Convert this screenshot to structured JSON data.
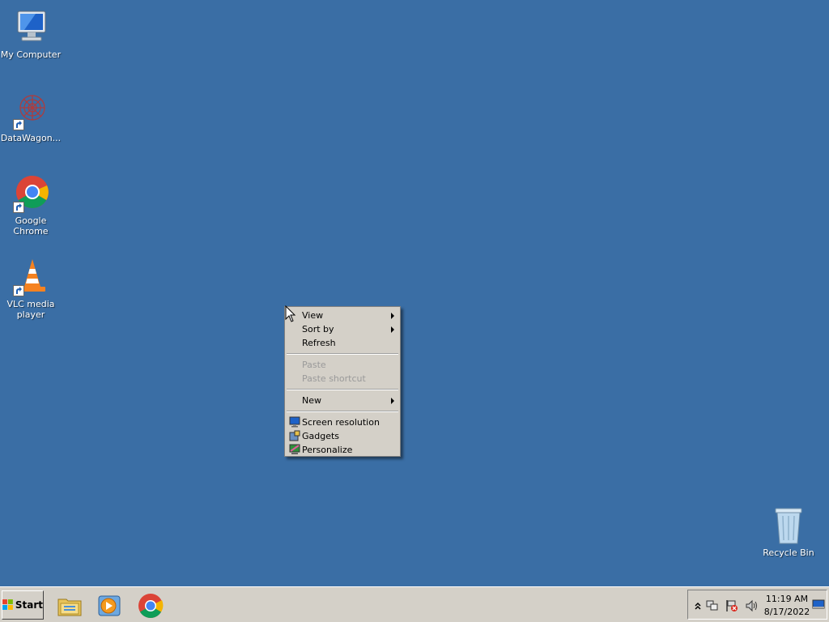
{
  "desktop": {
    "icons": [
      {
        "label": "My Computer",
        "icon": "computer-icon"
      },
      {
        "label": "DataWagon...",
        "icon": "datawagon-icon"
      },
      {
        "label": "Google Chrome",
        "icon": "chrome-icon"
      },
      {
        "label": "VLC media player",
        "icon": "vlc-icon"
      },
      {
        "label": "Recycle Bin",
        "icon": "recycle-bin-icon"
      }
    ]
  },
  "context_menu": {
    "items": [
      {
        "label": "View",
        "submenu": true,
        "enabled": true
      },
      {
        "label": "Sort by",
        "submenu": true,
        "enabled": true
      },
      {
        "label": "Refresh",
        "enabled": true
      },
      {
        "label": "Paste",
        "enabled": false
      },
      {
        "label": "Paste shortcut",
        "enabled": false
      },
      {
        "label": "New",
        "submenu": true,
        "enabled": true
      },
      {
        "label": "Screen resolution",
        "icon": "screen-resolution-icon",
        "enabled": true
      },
      {
        "label": "Gadgets",
        "icon": "gadgets-icon",
        "enabled": true
      },
      {
        "label": "Personalize",
        "icon": "personalize-icon",
        "enabled": true
      }
    ]
  },
  "taskbar": {
    "start_label": "Start",
    "pinned": [
      {
        "icon": "file-explorer-icon"
      },
      {
        "icon": "media-player-icon"
      },
      {
        "icon": "chrome-icon"
      }
    ],
    "tray": {
      "icons": [
        "show-hidden-icons-chevron-icon",
        "network-icon",
        "action-center-flag-icon",
        "volume-icon"
      ],
      "time": "11:19 AM",
      "date": "8/17/2022"
    }
  },
  "colors": {
    "desktop_background": "#3a6ea5",
    "menu_background": "#d4d0c8",
    "taskbar_background": "#d4d0c8"
  }
}
